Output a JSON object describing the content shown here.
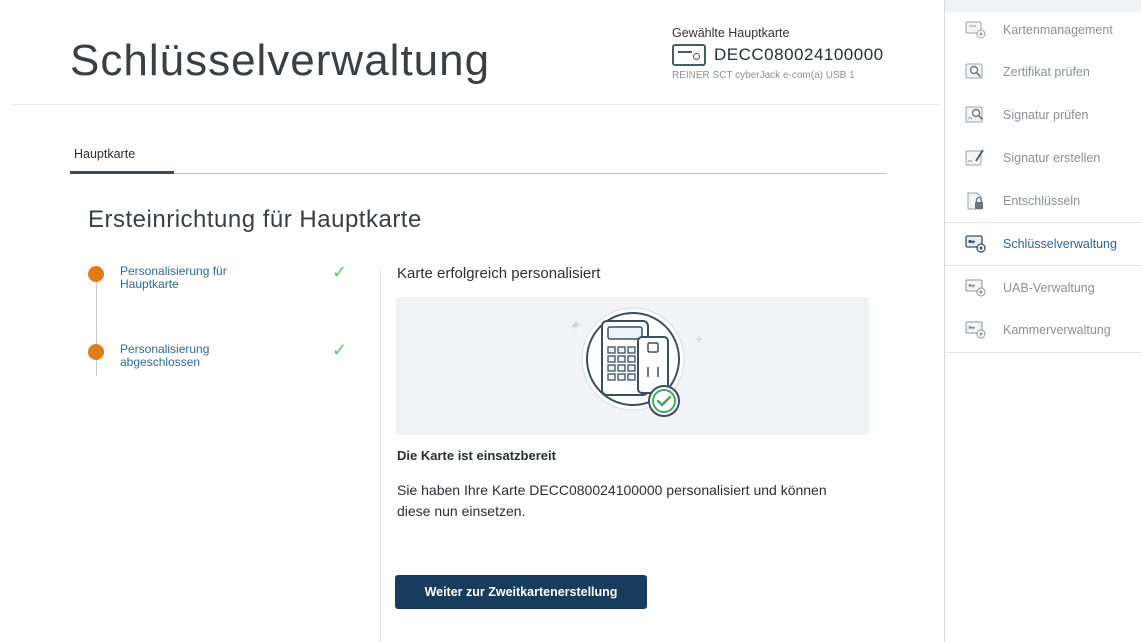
{
  "header": {
    "title": "Schlüsselverwaltung",
    "card_label": "Gewählte Hauptkarte",
    "card_number": "DECC080024100000",
    "reader": "REINER SCT cyberJack e-com(a) USB 1"
  },
  "tabs": [
    {
      "label": "Hauptkarte",
      "active": true
    }
  ],
  "section_title": "Ersteinrichtung für Hauptkarte",
  "steps": [
    {
      "label": "Personalisierung für Hauptkarte",
      "done": true
    },
    {
      "label": "Personalisierung abgeschlossen",
      "done": true
    }
  ],
  "step_check_glyph": "✓",
  "result": {
    "title": "Karte erfolgreich personalisiert",
    "ready": "Die Karte ist einsatzbereit",
    "description": "Sie haben Ihre Karte DECC080024100000 personalisiert und können diese nun einsetzen.",
    "button": "Weiter zur Zweitkartenerstellung"
  },
  "sidebar": {
    "items": [
      {
        "label": "Kartenmanagement",
        "icon": "card-gear-icon",
        "active": false
      },
      {
        "label": "Zertifikat prüfen",
        "icon": "certificate-search-icon",
        "active": false
      },
      {
        "label": "Signatur prüfen",
        "icon": "signature-search-icon",
        "active": false
      },
      {
        "label": "Signatur erstellen",
        "icon": "signature-pen-icon",
        "active": false
      },
      {
        "label": "Entschlüsseln",
        "icon": "document-lock-icon",
        "active": false
      },
      {
        "label": "Schlüsselverwaltung",
        "icon": "key-gear-icon",
        "active": true
      },
      {
        "label": "UAB-Verwaltung",
        "icon": "key-gear-icon",
        "active": false
      },
      {
        "label": "Kammerverwaltung",
        "icon": "key-gear-icon",
        "active": false
      }
    ]
  },
  "colors": {
    "accent": "#173c5e",
    "step_dot": "#e07b1a",
    "check": "#6fbf73",
    "active_nav": "#2f6690"
  }
}
